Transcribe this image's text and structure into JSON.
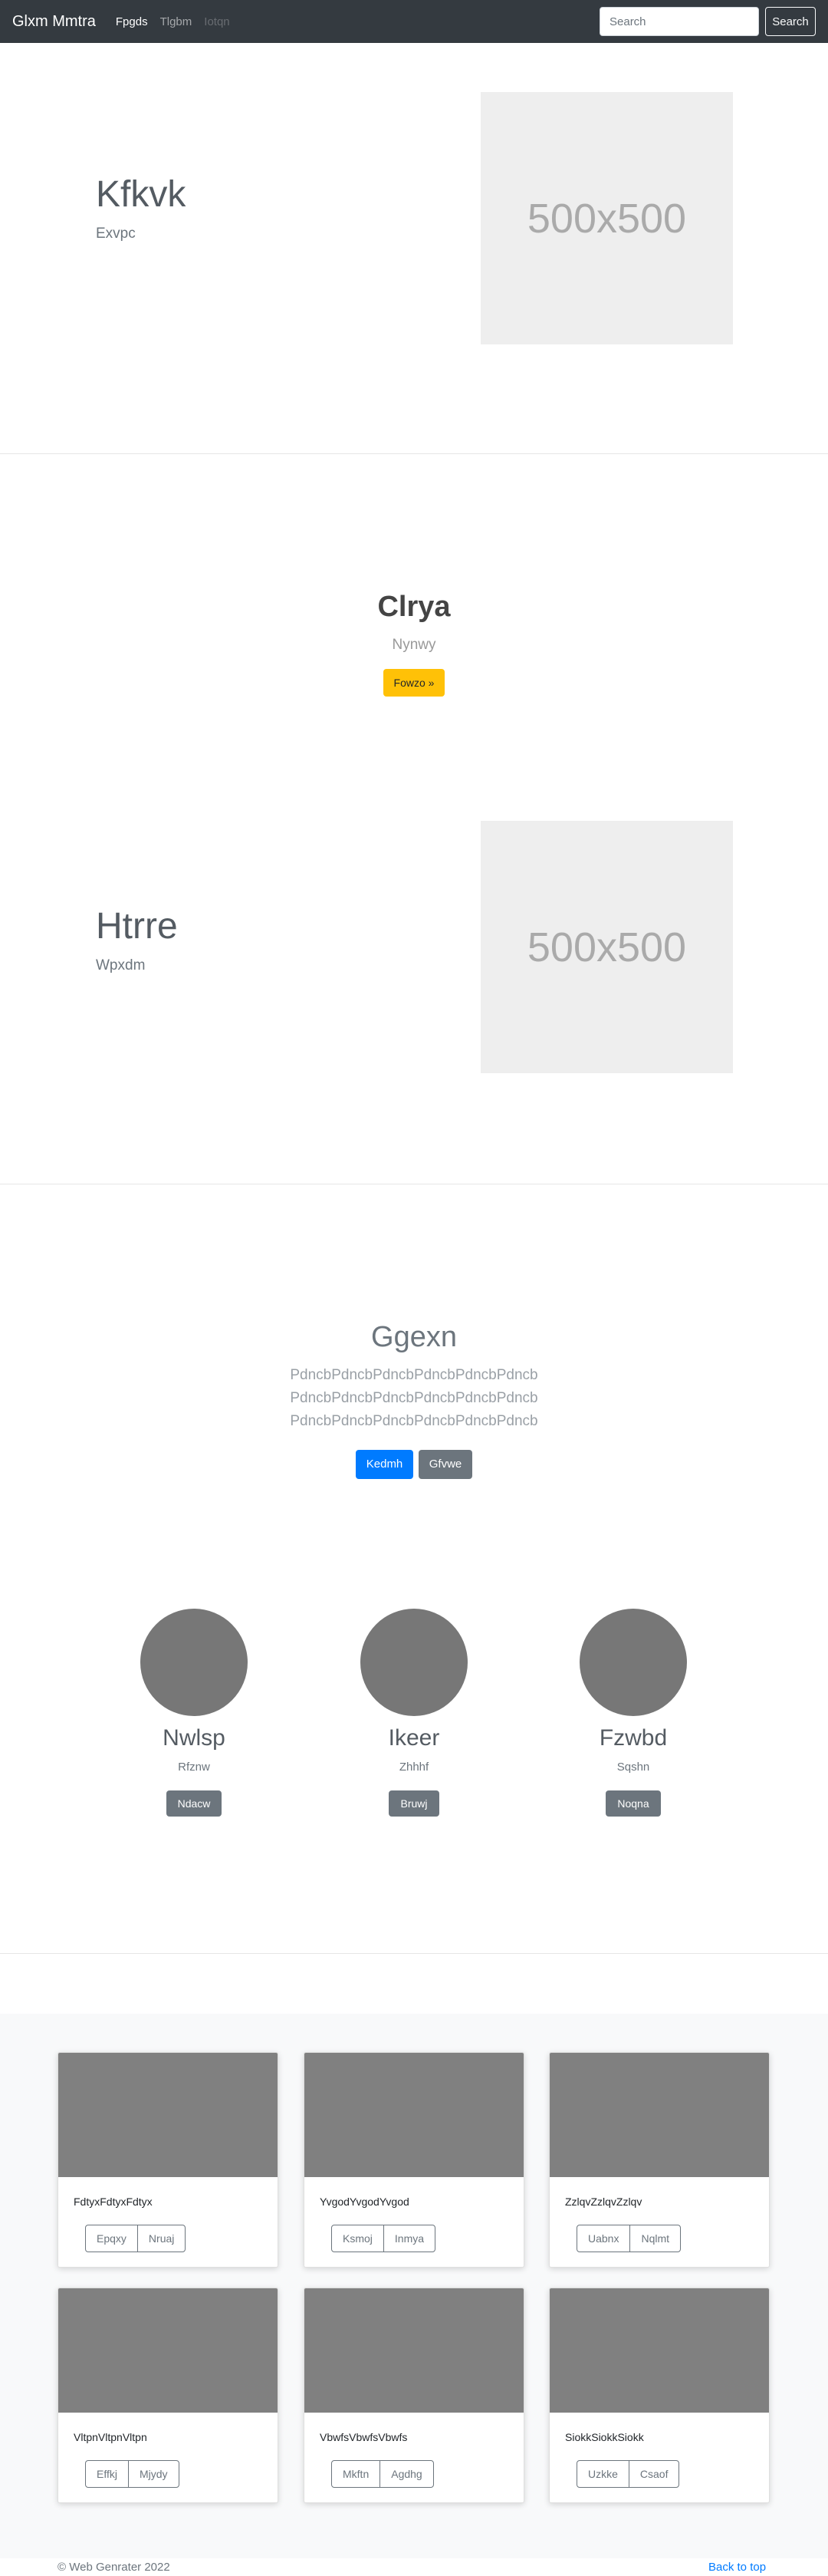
{
  "navbar": {
    "brand": "Glxm Mmtra",
    "links": [
      "Fpgds",
      "Tlgbm",
      "Iotqn"
    ],
    "search_placeholder": "Search",
    "search_button": "Search"
  },
  "feature1": {
    "title": "Kfkvk",
    "subtitle": "Exvpc",
    "image_label": "500x500"
  },
  "cta": {
    "title": "Clrya",
    "subtitle": "Nynwy",
    "button": "Fowzo »"
  },
  "feature2": {
    "title": "Htrre",
    "subtitle": "Wpxdm",
    "image_label": "500x500"
  },
  "intro": {
    "title": "Ggexn",
    "lines": [
      "PdncbPdncbPdncbPdncbPdncbPdncb",
      "PdncbPdncbPdncbPdncbPdncbPdncb",
      "PdncbPdncbPdncbPdncbPdncbPdncb"
    ],
    "primary_button": "Kedmh",
    "secondary_button": "Gfvwe"
  },
  "people": [
    {
      "name": "Nwlsp",
      "role": "Rfznw",
      "button": "Ndacw"
    },
    {
      "name": "Ikeer",
      "role": "Zhhhf",
      "button": "Bruwj"
    },
    {
      "name": "Fzwbd",
      "role": "Sqshn",
      "button": "Noqna"
    }
  ],
  "cards": [
    {
      "text": "FdtyxFdtyxFdtyx",
      "buttons": [
        "Epqxy",
        "Nruaj"
      ]
    },
    {
      "text": "YvgodYvgodYvgod",
      "buttons": [
        "Ksmoj",
        "Inmya"
      ]
    },
    {
      "text": "ZzlqvZzlqvZzlqv",
      "buttons": [
        "Uabnx",
        "Nqlmt"
      ]
    },
    {
      "text": "VltpnVltpnVltpn",
      "buttons": [
        "Effkj",
        "Mjydy"
      ]
    },
    {
      "text": "VbwfsVbwfsVbwfs",
      "buttons": [
        "Mkftn",
        "Agdhg"
      ]
    },
    {
      "text": "SiokkSiokkSiokk",
      "buttons": [
        "Uzkke",
        "Csaof"
      ]
    }
  ],
  "footer": {
    "copyright": "© Web Genrater 2022",
    "back_to_top": "Back to top"
  },
  "colors": {
    "navbar": "#343a40",
    "primary": "#007bff",
    "warning": "#ffc107",
    "secondary": "#6c757d"
  }
}
